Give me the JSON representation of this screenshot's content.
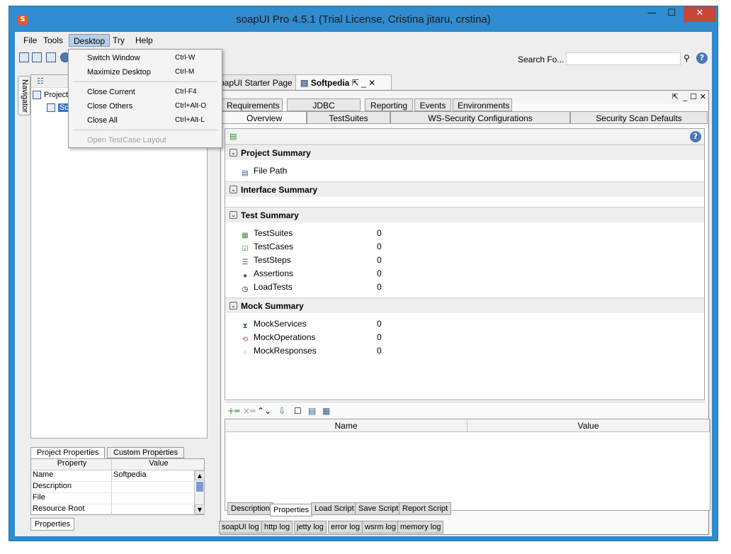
{
  "window": {
    "title": "soapUI Pro 4.5.1 (Trial License, Cristina jitaru, crstina)",
    "min": "—",
    "max": "☐",
    "close": "✕"
  },
  "menu": {
    "file": "File",
    "tools": "Tools",
    "desktop": "Desktop",
    "try": "Try",
    "help": "Help"
  },
  "toolbar": {
    "search_label": "Search Fo...",
    "search_value": ""
  },
  "desktop_menu": {
    "switch_window": "Switch Window",
    "switch_window_sc": "Ctrl-W",
    "maximize_desktop": "Maximize Desktop",
    "maximize_desktop_sc": "Ctrl-M",
    "close_current": "Close Current",
    "close_current_sc": "Ctrl-F4",
    "close_others": "Close Others",
    "close_others_sc": "Ctrl+Alt-O",
    "close_all": "Close All",
    "close_all_sc": "Ctrl+Alt-L",
    "open_testcase_layout": "Open TestCase Layout"
  },
  "navigator": {
    "tab_label": "Navigator",
    "tree": {
      "projects": "Project",
      "softpedia": "Sof"
    }
  },
  "properties": {
    "tab_project": "Project Properties",
    "tab_custom": "Custom Properties",
    "col_property": "Property",
    "col_value": "Value",
    "rows": [
      {
        "name": "Name",
        "value": "Softpedia"
      },
      {
        "name": "Description",
        "value": ""
      },
      {
        "name": "File",
        "value": ""
      },
      {
        "name": "Resource Root",
        "value": ""
      }
    ],
    "bottom_tab": "Properties"
  },
  "doc_tabs": {
    "starter": "oapUI Starter Page",
    "softpedia": "Softpedia"
  },
  "sub_tabs": {
    "requirements": "Requirements",
    "jdbc": "JDBC Connections",
    "reporting": "Reporting",
    "events": "Events",
    "environments": "Environments",
    "overview": "Overview",
    "testsuites": "TestSuites",
    "wssec": "WS-Security Configurations",
    "security_scan": "Security Scan Defaults"
  },
  "overview": {
    "project_summary": "Project Summary",
    "file_path": "File Path",
    "interface_summary": "Interface Summary",
    "test_summary": "Test Summary",
    "test_rows": [
      {
        "label": "TestSuites",
        "value": "0"
      },
      {
        "label": "TestCases",
        "value": "0"
      },
      {
        "label": "TestSteps",
        "value": "0"
      },
      {
        "label": "Assertions",
        "value": "0"
      },
      {
        "label": "LoadTests",
        "value": "0"
      }
    ],
    "mock_summary": "Mock Summary",
    "mock_rows": [
      {
        "label": "MockServices",
        "value": "0"
      },
      {
        "label": "MockOperations",
        "value": "0"
      },
      {
        "label": "MockResponses",
        "value": "0"
      }
    ]
  },
  "nv_table": {
    "col_name": "Name",
    "col_value": "Value"
  },
  "script_tabs": {
    "description": "Description",
    "properties": "Properties",
    "load_script": "Load Script",
    "save_script": "Save Script",
    "report_script": "Report Script"
  },
  "log_tabs": {
    "soapui": "soapUI log",
    "http": "http log",
    "jetty": "jetty log",
    "error": "error log",
    "wsrm": "wsrm log",
    "memory": "memory log"
  },
  "colors": {
    "frame": "#2f8ccf",
    "accent": "#3a78c8",
    "close": "#c7463c"
  }
}
